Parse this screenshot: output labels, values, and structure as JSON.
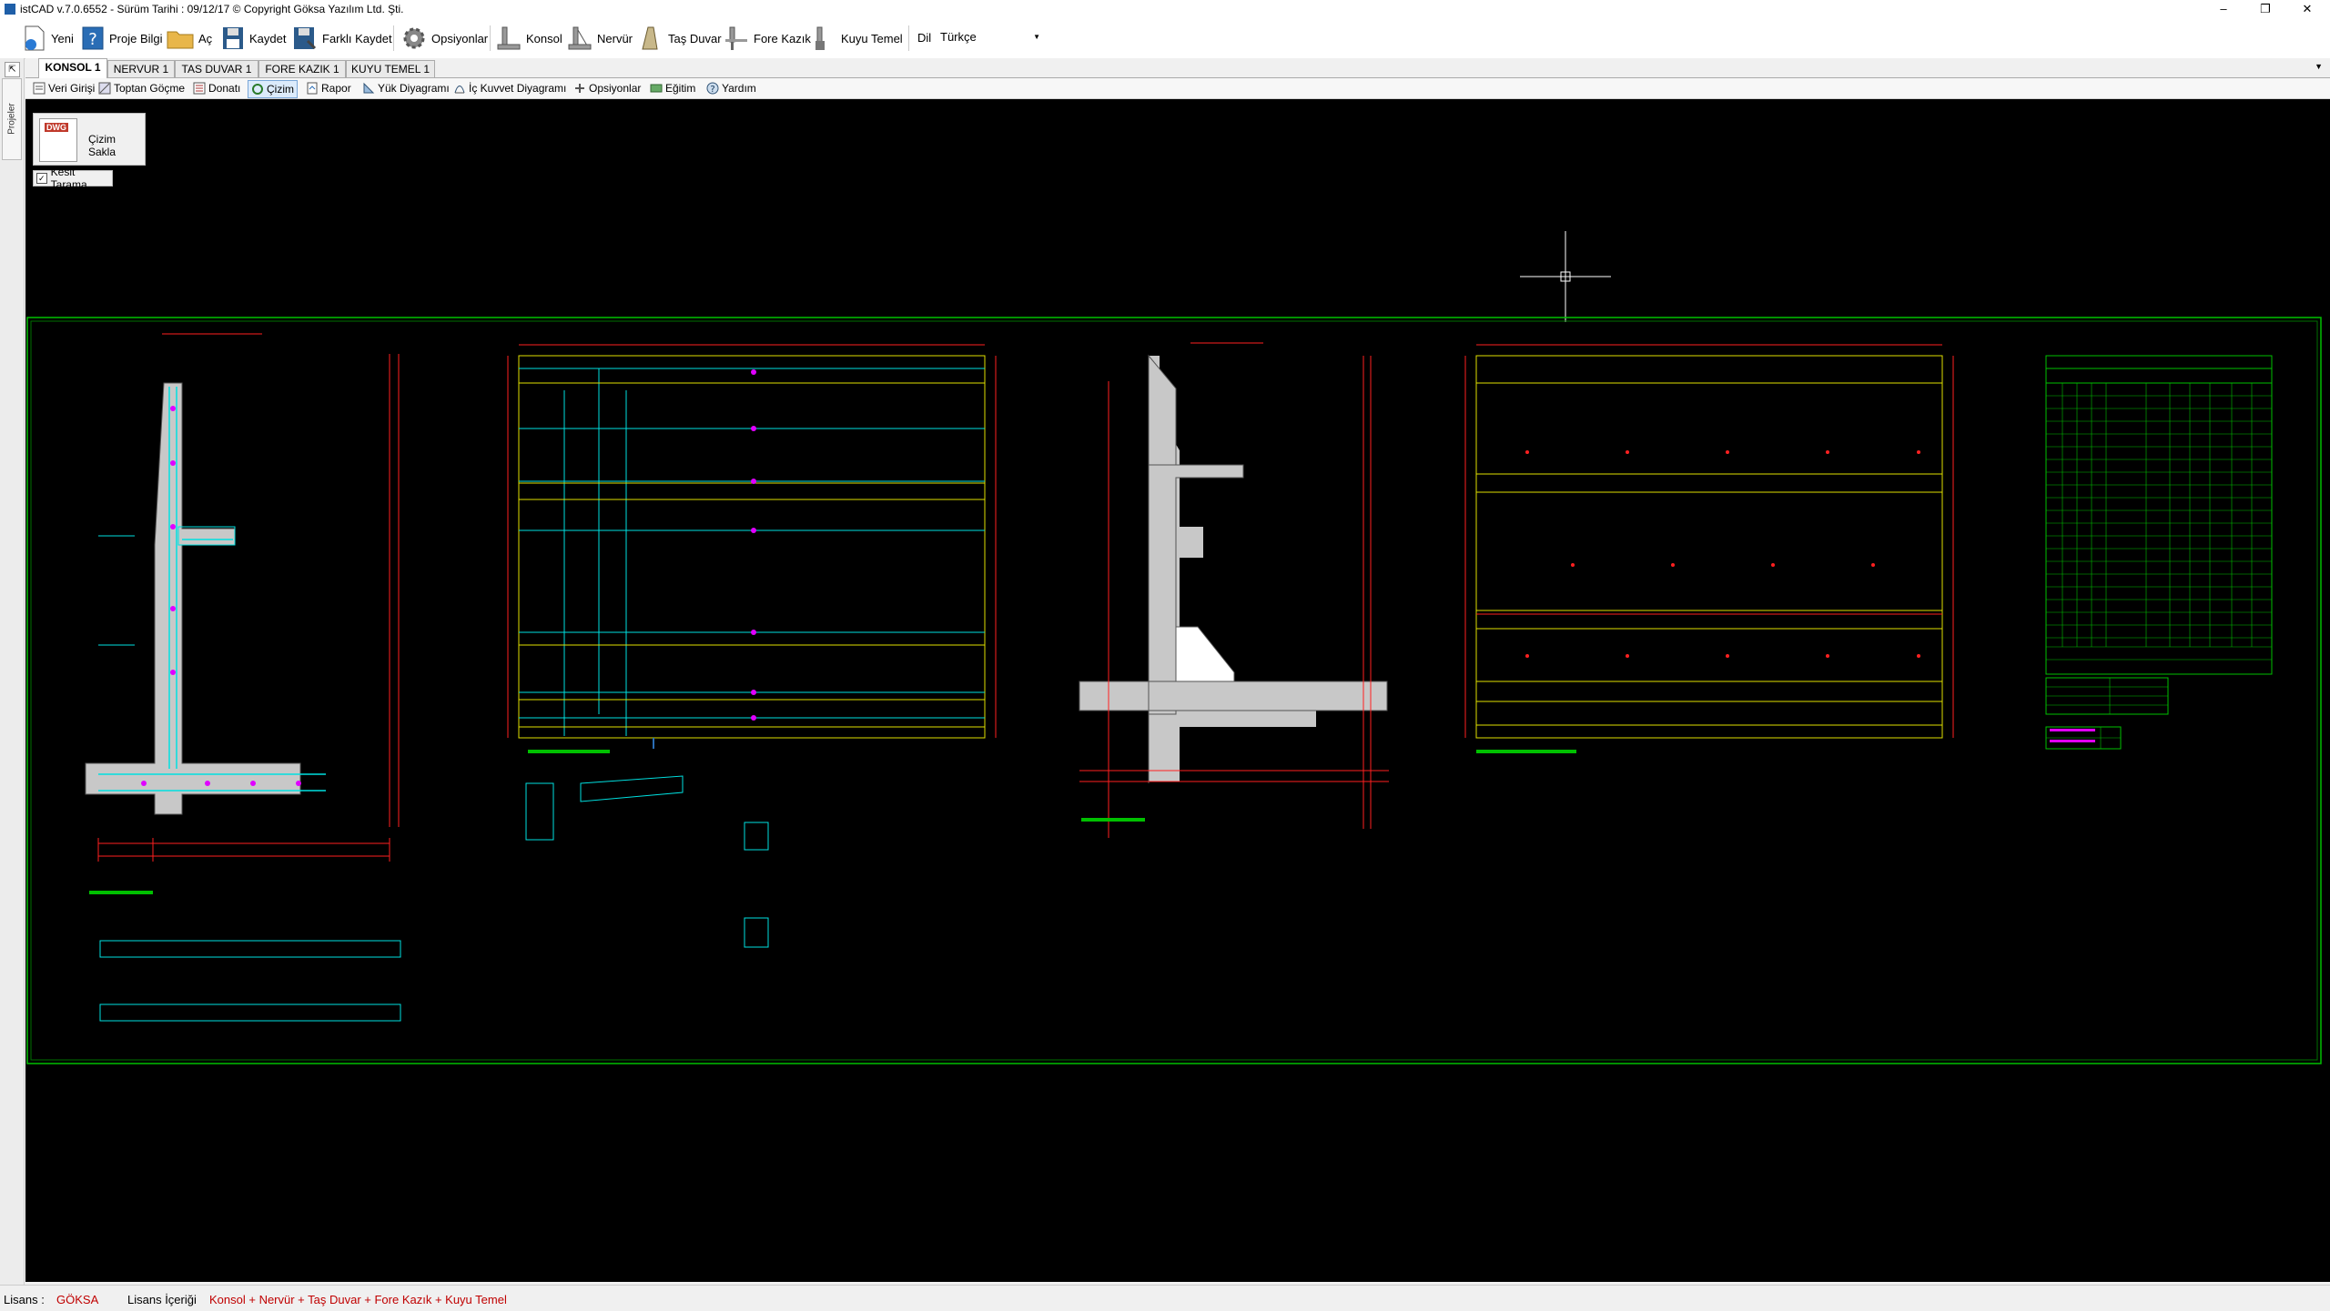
{
  "window": {
    "title": "istCAD v.7.0.6552 -  Sürüm Tarihi : 09/12/17  © Copyright Göksa Yazılım Ltd. Şti.",
    "minimize": "–",
    "maximize": "❐",
    "close": "✕"
  },
  "toolbar": {
    "new": "Yeni",
    "project_info": "Proje Bilgi",
    "open": "Aç",
    "save": "Kaydet",
    "save_as": "Farklı Kaydet",
    "options": "Opsiyonlar",
    "konsol": "Konsol",
    "nervur": "Nervür",
    "tas_duvar": "Taş Duvar",
    "fore_kazik": "Fore Kazık",
    "kuyu_temel": "Kuyu Temel",
    "language_label": "Dil",
    "language_value": "Türkçe"
  },
  "side_panel": {
    "label": "Projeler"
  },
  "tabs": [
    {
      "label": "KONSOL 1"
    },
    {
      "label": "NERVUR 1"
    },
    {
      "label": "TAS DUVAR 1"
    },
    {
      "label": "FORE KAZIK 1"
    },
    {
      "label": "KUYU TEMEL 1"
    }
  ],
  "subtoolbar": {
    "veri_girisi": "Veri Girişi",
    "toptan_gocme": "Toptan Göçme",
    "donati": "Donatı",
    "cizim": "Çizim",
    "rapor": "Rapor",
    "yuk_diyagrami": "Yük Diyagramı",
    "ic_kuvvet": "İç Kuvvet Diyagramı",
    "opsiyonlar": "Opsiyonlar",
    "egitim": "Eğitim",
    "yardim": "Yardım"
  },
  "drawing_panel": {
    "dwg_badge": "DWG",
    "save_drawing": "Çizim Sakla",
    "section_hatch": "Kesit Tarama",
    "section_hatch_checked": true
  },
  "status": {
    "license_label": "Lisans :",
    "license_value": "GÖKSA",
    "content_label": "Lisans İçeriği",
    "content_value": "Konsol + Nervür + Taş Duvar + Fore Kazık + Kuyu Temel"
  },
  "colors": {
    "frame_green": "#00c000",
    "dim_red": "#ff2020",
    "rebar_cyan": "#00e0e0",
    "mark_magenta": "#e000ff",
    "concrete_grey": "#c8c8c8",
    "outline_yellow": "#e0e000",
    "status_red": "#c00000"
  }
}
